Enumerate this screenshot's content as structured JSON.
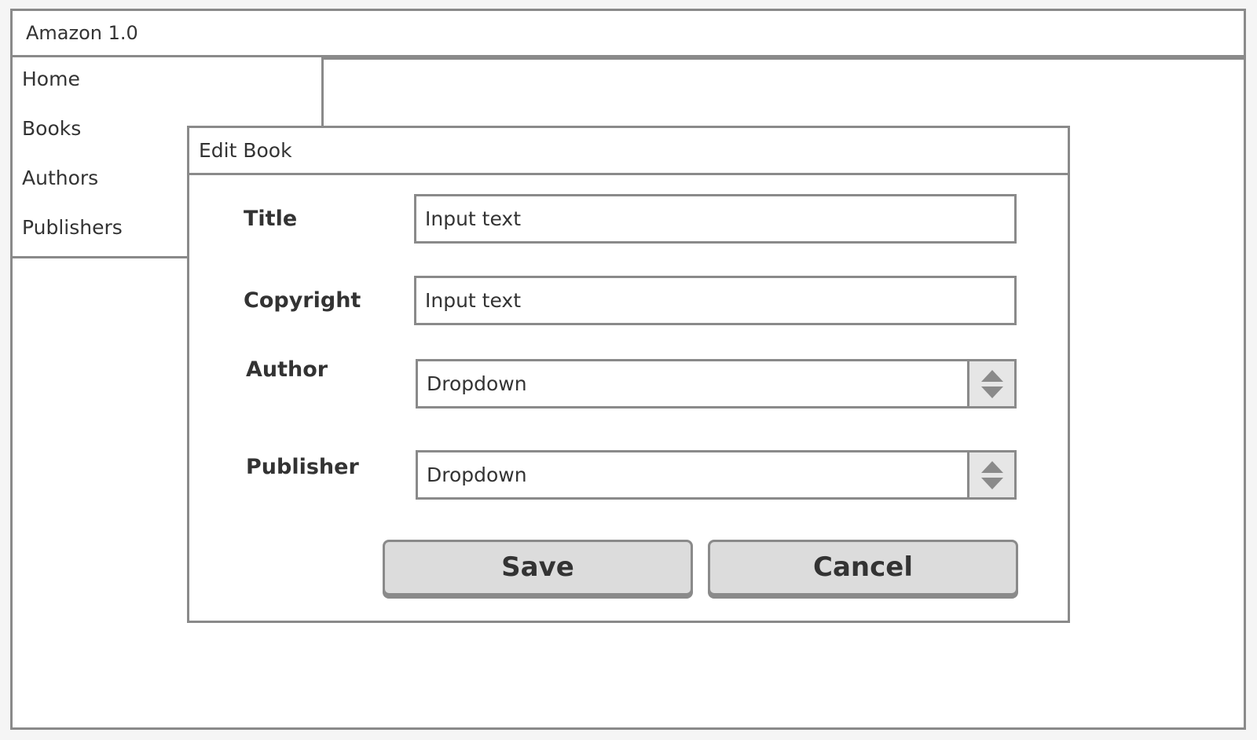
{
  "app": {
    "title": "Amazon 1.0"
  },
  "sidebar": {
    "items": [
      {
        "label": "Home"
      },
      {
        "label": "Books"
      },
      {
        "label": "Authors"
      },
      {
        "label": "Publishers"
      }
    ]
  },
  "dialog": {
    "title": "Edit Book",
    "fields": {
      "title": {
        "label": "Title",
        "value": "Input text"
      },
      "copyright": {
        "label": "Copyright",
        "value": "Input text"
      },
      "author": {
        "label": "Author",
        "value": "Dropdown"
      },
      "publisher": {
        "label": "Publisher",
        "value": "Dropdown"
      }
    },
    "buttons": {
      "save": "Save",
      "cancel": "Cancel"
    }
  },
  "colors": {
    "border": "#8a8a8a",
    "text": "#333333",
    "button_bg": "#dcdcdc",
    "background": "#ffffff"
  }
}
